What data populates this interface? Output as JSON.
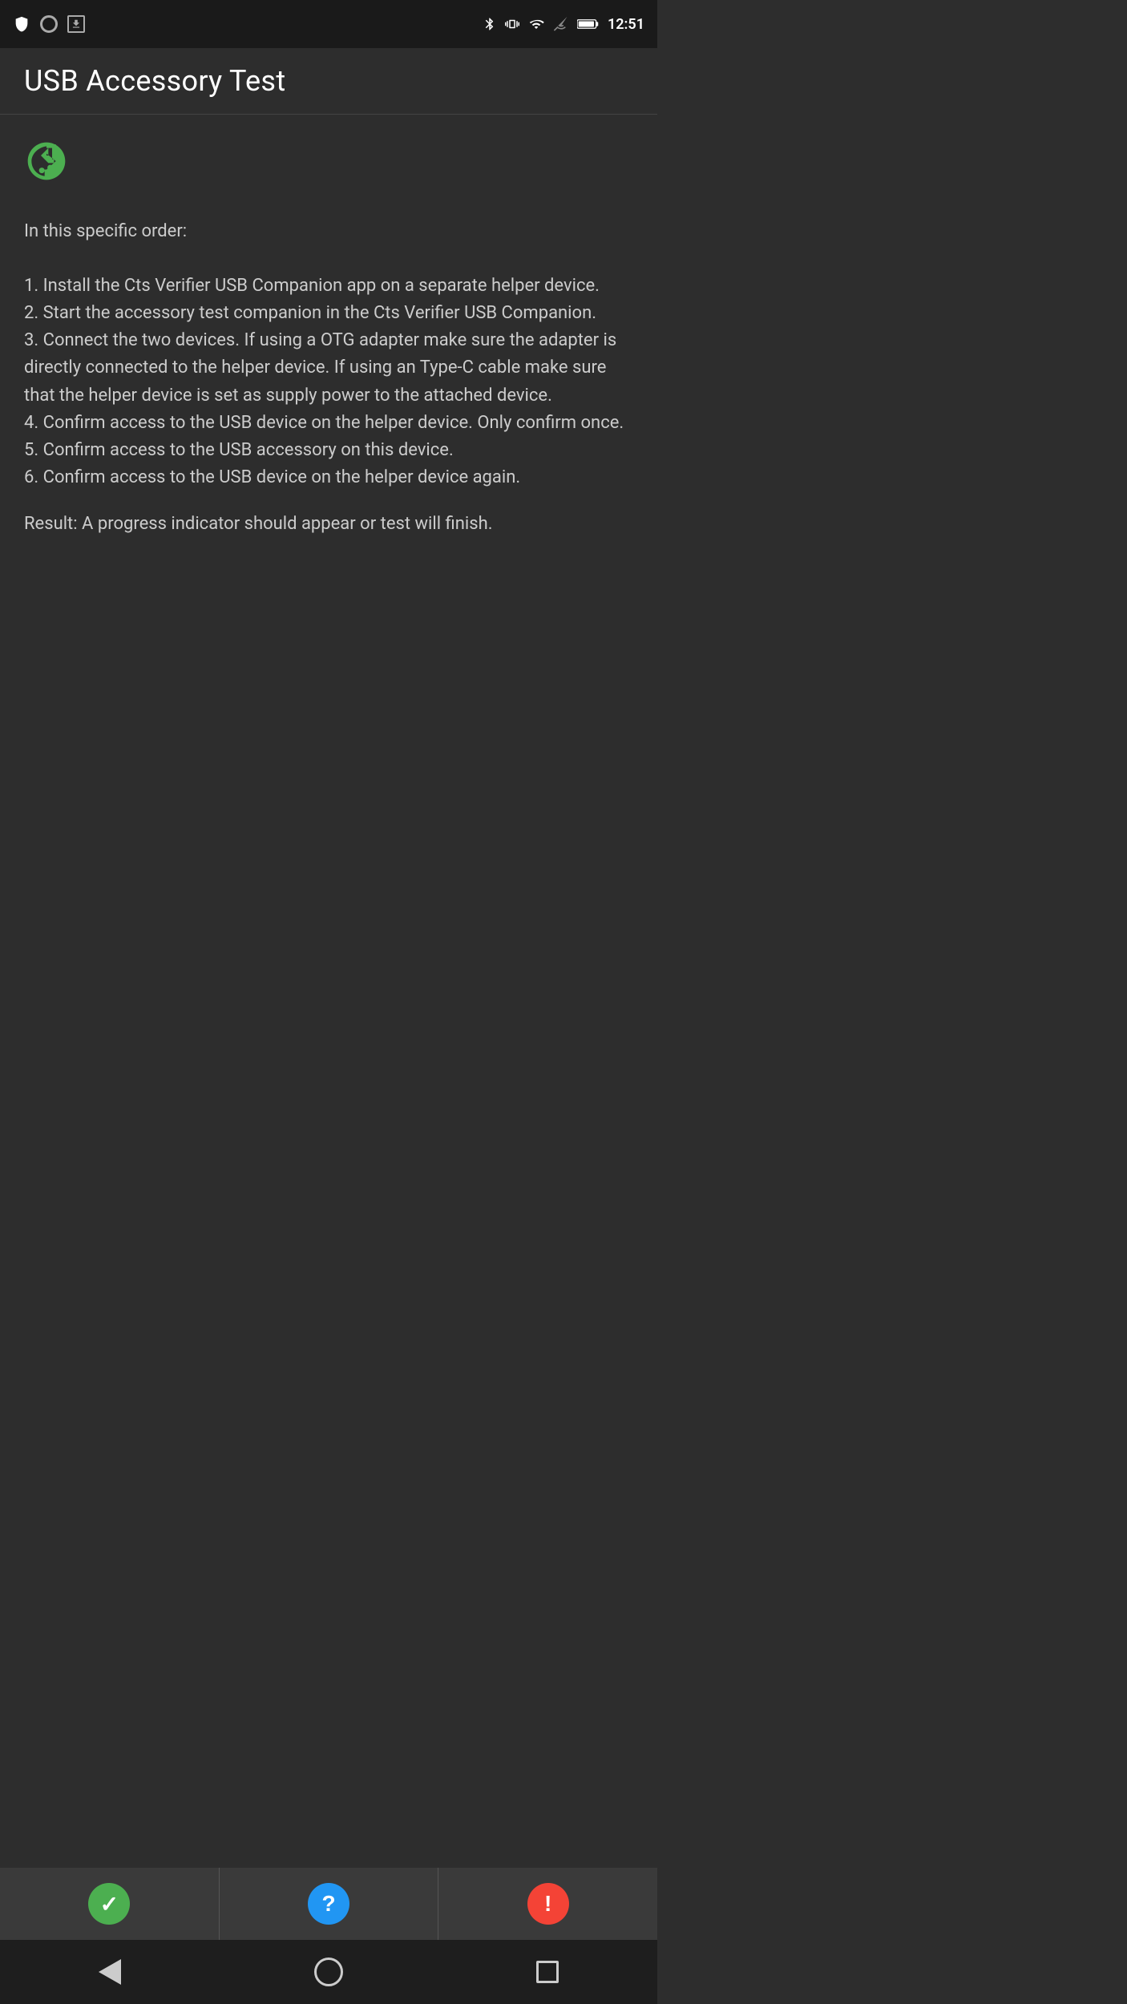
{
  "status_bar": {
    "time": "12:51",
    "icons_left": [
      "shield",
      "record",
      "download"
    ],
    "icons_right": [
      "bluetooth",
      "vibrate",
      "wifi",
      "signal",
      "battery"
    ]
  },
  "app_bar": {
    "title": "USB Accessory Test"
  },
  "content": {
    "usb_icon_label": "usb",
    "instructions_header": "In this specific order:",
    "steps": [
      "1. Install the Cts Verifier USB Companion app on a separate helper device.",
      "2. Start the accessory test companion in the Cts Verifier USB Companion.",
      "3. Connect the two devices. If using a OTG adapter make sure the adapter is directly connected to the helper device. If using an Type-C cable make sure that the helper device is set as supply power to the attached device.",
      "4. Confirm access to the USB device on the helper device. Only confirm once.",
      "5. Confirm access to the USB accessory on this device.",
      "6. Confirm access to the USB device on the helper device again."
    ],
    "result": "Result: A progress indicator should appear or test will finish."
  },
  "bottom_buttons": [
    {
      "id": "pass",
      "color": "green",
      "icon": "✓",
      "label": "Pass"
    },
    {
      "id": "info",
      "color": "blue",
      "icon": "?",
      "label": "Info"
    },
    {
      "id": "fail",
      "color": "red",
      "icon": "!",
      "label": "Fail"
    }
  ],
  "nav_bar": {
    "back_label": "Back",
    "home_label": "Home",
    "overview_label": "Overview"
  },
  "colors": {
    "usb_icon": "#4caf50",
    "pass_btn": "#4caf50",
    "info_btn": "#2196f3",
    "fail_btn": "#f44336",
    "background": "#2d2d2d",
    "app_bar": "#2d2d2d",
    "status_bar": "#1a1a1a"
  }
}
